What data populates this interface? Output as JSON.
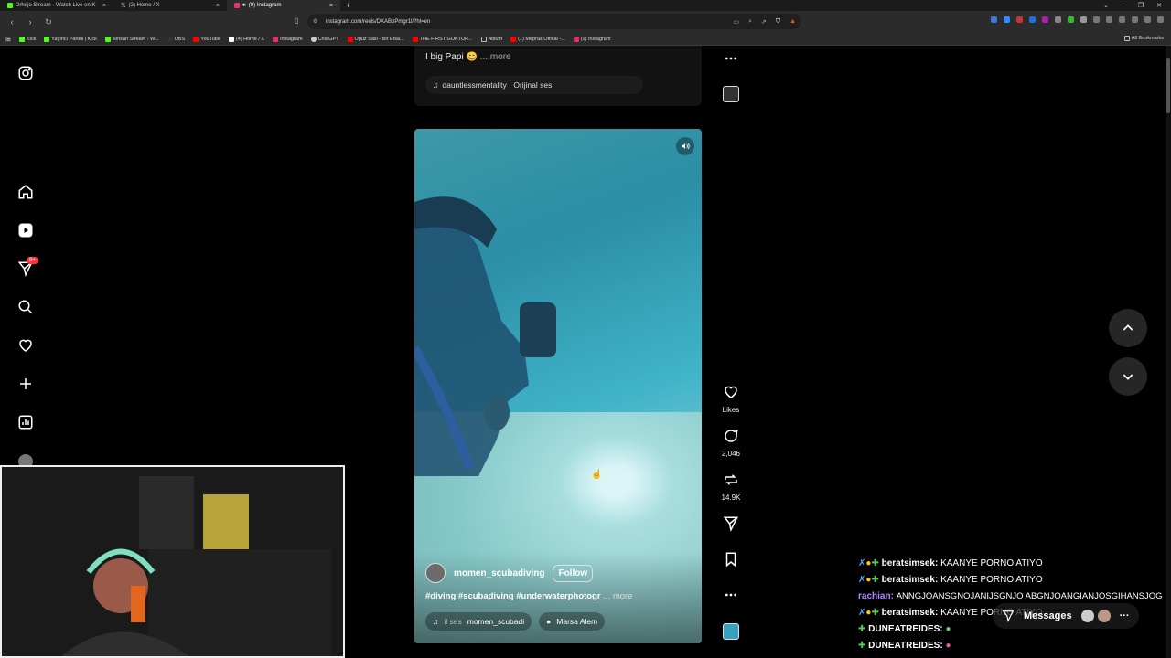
{
  "browser": {
    "tabs": [
      {
        "title": "Drhejo Stream - Watch Live on K",
        "color": "#53fc18"
      },
      {
        "title": "(2) Home / X",
        "color": "#ffffff"
      },
      {
        "title": "(9) Instagram",
        "color": "#e1306c"
      }
    ],
    "url": "instagram.com/reels/DXABbPmgr1l/?hl=en",
    "bookmarks": [
      "Kick",
      "Yayıncı Paneli | Kick",
      "ikinsan Stream - W...",
      "OBS",
      "YouTube",
      "(4) Home / X",
      "Instagram",
      "ChatGPT",
      "Oğuz Sasi - Bir Efsa...",
      "THE FIRST GOKTUR...",
      "Albüm",
      "(1) Mepraz Offical -...",
      "(9) Instagram"
    ],
    "all_bookmarks": "All Bookmarks"
  },
  "sidebar": {
    "notifications_badge": "9+"
  },
  "prev_reel": {
    "caption": "I big Papi 😄",
    "more": "... more",
    "audio": "dauntlessmentality · Orijinal ses"
  },
  "reel": {
    "username": "momen_scubadiving",
    "follow_label": "Follow",
    "caption": "#diving #scubadiving #underwaterphotogr",
    "more": "... more",
    "audio_prefix": "il ses",
    "audio_user": "momen_scubadi",
    "location": "Marsa Alem"
  },
  "actions": {
    "likes_label": "Likes",
    "comments": "2,046",
    "reposts": "14.9K"
  },
  "chat": [
    {
      "user": "beratsimsek:",
      "text": "KAANYE PORNO ATIYO",
      "style": "u1"
    },
    {
      "user": "beratsimsek:",
      "text": "KAANYE PORNO ATIYO",
      "style": "u1"
    },
    {
      "user": "rachian:",
      "text": "ANNGJOANSGNOJANIJSGNJO ABGNJOANGIANJOSGIHANSJOG",
      "style": "u2"
    },
    {
      "user": "beratsimsek:",
      "text": "KAANYE PORNO ATIYO",
      "style": "u1"
    },
    {
      "user": "DUNEATREIDES:",
      "text": "",
      "style": "u1"
    },
    {
      "user": "DUNEATREIDES:",
      "text": "",
      "style": "u1"
    }
  ],
  "messages_label": "Messages"
}
